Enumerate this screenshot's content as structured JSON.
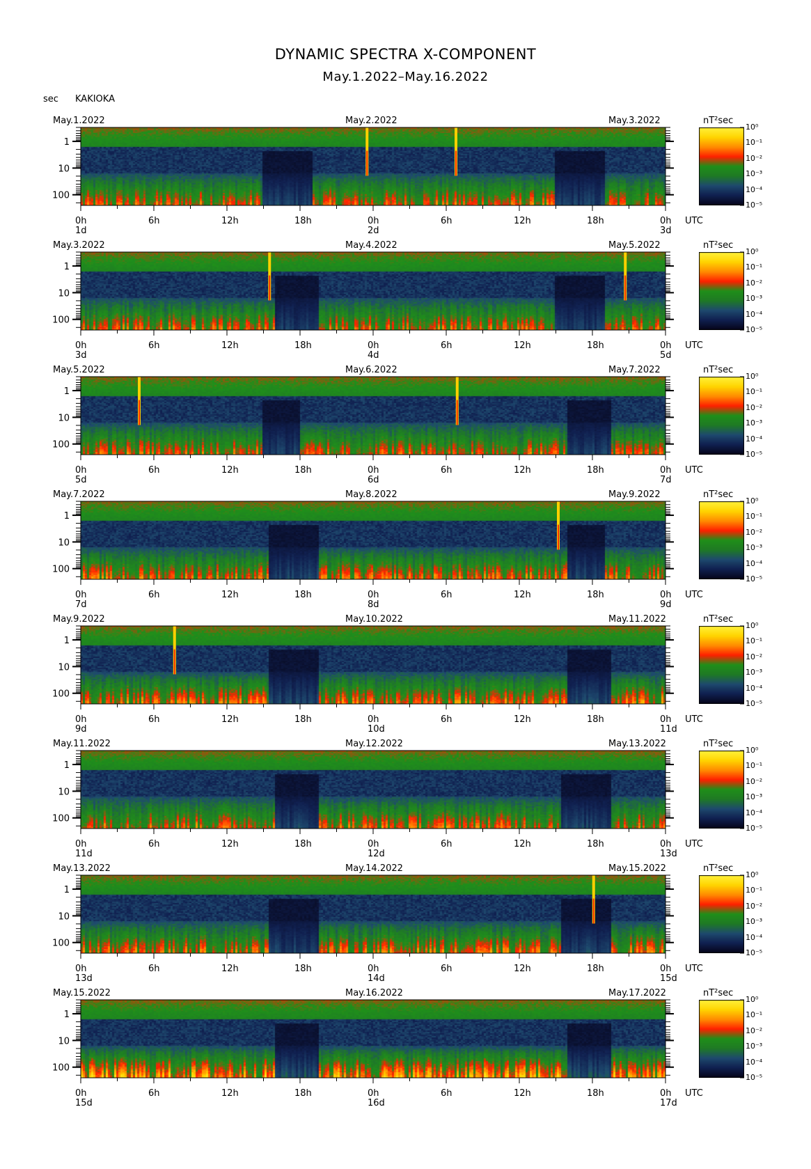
{
  "header": {
    "title": "DYNAMIC SPECTRA X-COMPONENT",
    "subtitle": "May.1.2022–May.16.2022",
    "y_unit": "sec",
    "station": "KAKIOKA"
  },
  "colors": {
    "background": "#ffffff",
    "colormap": [
      "#06061a",
      "#102050",
      "#1e4a6e",
      "#1f7a25",
      "#1f8f1a",
      "#ff2000",
      "#ff8c00",
      "#ffd400",
      "#fff23a"
    ]
  },
  "chart_data": {
    "type": "heatmap",
    "x_label": "UTC",
    "x_ticks": [
      "0h",
      "6h",
      "12h",
      "18h",
      "0h",
      "6h",
      "12h",
      "18h",
      "0h"
    ],
    "y_ticks": [
      "1",
      "10",
      "100"
    ],
    "y_scale": "log",
    "y_range_sec": [
      0.3,
      250
    ],
    "colorbar_unit": "nT²sec",
    "colorbar_ticks": [
      "10⁰",
      "10⁻¹",
      "10⁻²",
      "10⁻³",
      "10⁻⁴",
      "10⁻⁵"
    ],
    "colorbar_range_log10": [
      -5,
      0
    ],
    "panels": [
      {
        "start_label": "May.1.2022",
        "mid_label": "May.2.2022",
        "end_label": "May.3.2022",
        "day_labels": [
          "1d",
          "2d",
          "3d"
        ],
        "spikes": [
          {
            "hour": 23.5,
            "top_sec": 0.3
          },
          {
            "hour": 30.8,
            "top_sec": 0.3
          }
        ],
        "quiet_hours": [
          [
            15,
            19
          ],
          [
            39,
            43
          ]
        ],
        "activity": 0.45
      },
      {
        "start_label": "May.3.2022",
        "mid_label": "May.4.2022",
        "end_label": "May.5.2022",
        "day_labels": [
          "3d",
          "4d",
          "5d"
        ],
        "spikes": [
          {
            "hour": 15.5,
            "top_sec": 0.3
          },
          {
            "hour": 44.7,
            "top_sec": 0.3
          }
        ],
        "quiet_hours": [
          [
            16,
            19.5
          ],
          [
            39,
            43
          ]
        ],
        "activity": 0.45
      },
      {
        "start_label": "May.5.2022",
        "mid_label": "May.6.2022",
        "end_label": "May.7.2022",
        "day_labels": [
          "5d",
          "6d",
          "7d"
        ],
        "spikes": [
          {
            "hour": 4.8,
            "top_sec": 0.3
          },
          {
            "hour": 30.9,
            "top_sec": 0.3
          }
        ],
        "quiet_hours": [
          [
            15,
            18
          ],
          [
            40,
            43.5
          ]
        ],
        "activity": 0.45
      },
      {
        "start_label": "May.7.2022",
        "mid_label": "May.8.2022",
        "end_label": "May.9.2022",
        "day_labels": [
          "7d",
          "8d",
          "9d"
        ],
        "spikes": [
          {
            "hour": 39.2,
            "top_sec": 0.3
          }
        ],
        "quiet_hours": [
          [
            15.5,
            19.5
          ],
          [
            40,
            43
          ]
        ],
        "activity": 0.5
      },
      {
        "start_label": "May.9.2022",
        "mid_label": "May.10.2022",
        "end_label": "May.11.2022",
        "day_labels": [
          "9d",
          "10d",
          "11d"
        ],
        "spikes": [
          {
            "hour": 7.7,
            "top_sec": 0.3
          }
        ],
        "quiet_hours": [
          [
            15.5,
            19.5
          ],
          [
            40,
            43.5
          ]
        ],
        "activity": 0.55
      },
      {
        "start_label": "May.11.2022",
        "mid_label": "May.12.2022",
        "end_label": "May.13.2022",
        "day_labels": [
          "11d",
          "12d",
          "13d"
        ],
        "spikes": [],
        "quiet_hours": [
          [
            16,
            19.5
          ],
          [
            39.5,
            43.5
          ]
        ],
        "activity": 0.5
      },
      {
        "start_label": "May.13.2022",
        "mid_label": "May.14.2022",
        "end_label": "May.15.2022",
        "day_labels": [
          "13d",
          "14d",
          "15d"
        ],
        "spikes": [
          {
            "hour": 42.1,
            "top_sec": 0.3
          }
        ],
        "quiet_hours": [
          [
            15.5,
            19.5
          ],
          [
            39.5,
            43.5
          ]
        ],
        "activity": 0.5
      },
      {
        "start_label": "May.15.2022",
        "mid_label": "May.16.2022",
        "end_label": "May.17.2022",
        "day_labels": [
          "15d",
          "16d",
          "17d"
        ],
        "spikes": [],
        "quiet_hours": [
          [
            16,
            19.5
          ],
          [
            40,
            43.5
          ]
        ],
        "activity": 0.8
      }
    ]
  }
}
